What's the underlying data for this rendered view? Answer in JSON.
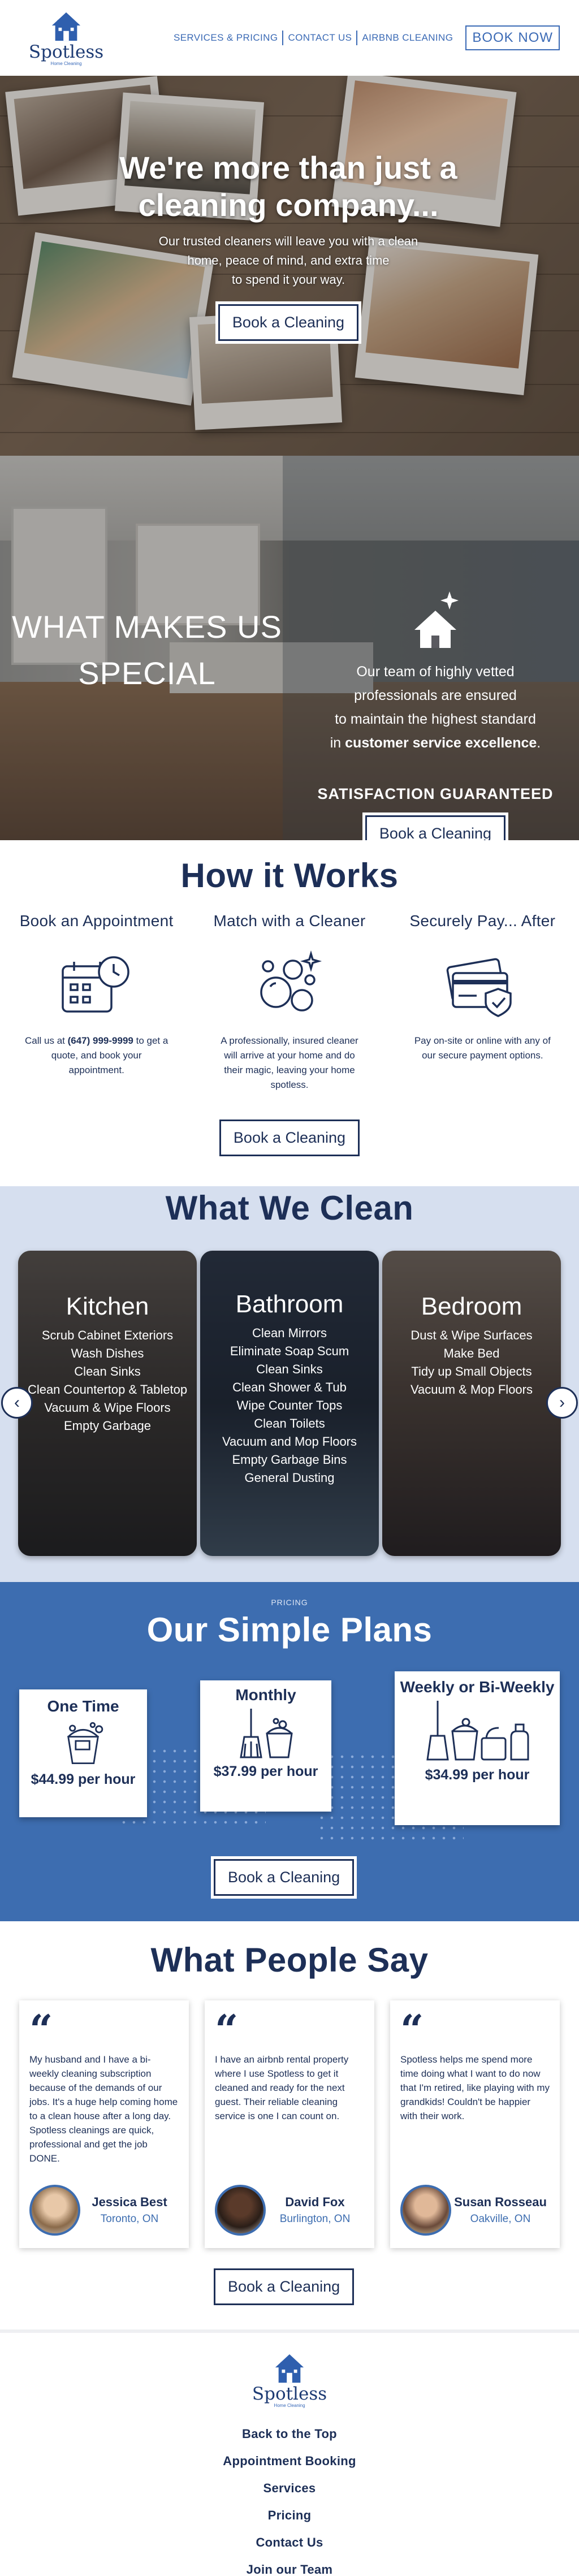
{
  "header": {
    "logo_word": "Spotless",
    "logo_tagline": "Home Cleaning",
    "nav": [
      "SERVICES & PRICING",
      "CONTACT US",
      "AIRBNB CLEANING"
    ],
    "book_now": "BOOK NOW"
  },
  "hero": {
    "title_line1": "We're more than just a",
    "title_line2": "cleaning company...",
    "sub_line1": "Our trusted cleaners will leave you with a clean",
    "sub_line2": "home, peace of mind, and extra time",
    "sub_line3": "to spend it your way.",
    "cta": "Book a Cleaning"
  },
  "special": {
    "title_line1": "WHAT MAKES US",
    "title_line2": "SPECIAL",
    "body_line1": "Our team of highly vetted",
    "body_line2": "professionals are ensured",
    "body_line3": "to maintain the highest standard",
    "body_line4_pre": "in ",
    "body_line4_bold": "customer service excellence",
    "body_line4_post": ".",
    "guarantee": "SATISFACTION GUARANTEED",
    "cta": "Book a Cleaning"
  },
  "how": {
    "title": "How it Works",
    "steps": [
      {
        "title": "Book an Appointment",
        "icon": "calendar-clock-icon",
        "desc_pre": "Call us at ",
        "desc_bold": "(647) 999-9999",
        "desc_post": " to get a quote, and book your appointment."
      },
      {
        "title": "Match with a Cleaner",
        "icon": "bubbles-icon",
        "desc": "A professionally, insured cleaner will arrive at your home and do their magic, leaving your home spotless."
      },
      {
        "title": "Securely Pay... After",
        "icon": "credit-card-shield-icon",
        "desc": "Pay on-site or online with any of our secure payment options."
      }
    ],
    "cta": "Book a Cleaning"
  },
  "clean": {
    "title": "What We Clean",
    "cards": [
      {
        "title": "Kitchen",
        "items": [
          "Scrub Cabinet Exteriors",
          "Wash Dishes",
          "Clean Sinks",
          "Clean Countertop & Tabletop",
          "Vacuum & Wipe Floors",
          "Empty Garbage"
        ]
      },
      {
        "title": "Bathroom",
        "items": [
          "Clean Mirrors",
          "Eliminate Soap Scum",
          "Clean Sinks",
          "Clean Shower & Tub",
          "Wipe Counter Tops",
          "Clean Toilets",
          "Vacuum and Mop Floors",
          "Empty Garbage Bins",
          "General Dusting"
        ]
      },
      {
        "title": "Bedroom",
        "items": [
          "Dust & Wipe Surfaces",
          "Make Bed",
          "Tidy up Small Objects",
          "Vacuum & Mop Floors"
        ]
      }
    ],
    "prev_icon": "chevron-left-icon",
    "next_icon": "chevron-right-icon"
  },
  "plans": {
    "kicker": "PRICING",
    "title": "Our Simple Plans",
    "items": [
      {
        "name": "One Time",
        "price": "$44.99 per hour",
        "icon": "bucket-icon"
      },
      {
        "name": "Monthly",
        "price": "$37.99 per hour",
        "icon": "broom-bucket-icon"
      },
      {
        "name": "Weekly or Bi-Weekly",
        "price": "$34.99 per hour",
        "icon": "broom-supplies-icon"
      }
    ],
    "cta": "Book a Cleaning"
  },
  "testimonials": {
    "title": "What People Say",
    "items": [
      {
        "quote": "My husband and I have a bi-weekly cleaning subscription because of the demands of our jobs. It's a huge help coming home to a clean house after a long day. Spotless cleanings are quick, professional and get the job DONE.",
        "name": "Jessica Best",
        "location": "Toronto, ON"
      },
      {
        "quote": "I have an airbnb rental property where I use Spotless to get it cleaned and ready for the next guest. Their reliable cleaning service is one I can count on.",
        "name": "David Fox",
        "location": "Burlington, ON"
      },
      {
        "quote": "Spotless helps me spend more time doing what I want to do now that I'm retired, like playing with my grandkids! Couldn't be happier with their work.",
        "name": "Susan Rosseau",
        "location": "Oakville, ON"
      }
    ],
    "cta": "Book a Cleaning"
  },
  "footer": {
    "logo_word": "Spotless",
    "logo_tagline": "Home Cleaning",
    "links": [
      "Back to the Top",
      "Appointment Booking",
      "Services",
      "Pricing",
      "Contact Us",
      "Join our Team"
    ]
  },
  "colors": {
    "navy": "#1d2f57",
    "brand_blue": "#3d6db0",
    "light_blue_bg": "#d6dfef"
  }
}
